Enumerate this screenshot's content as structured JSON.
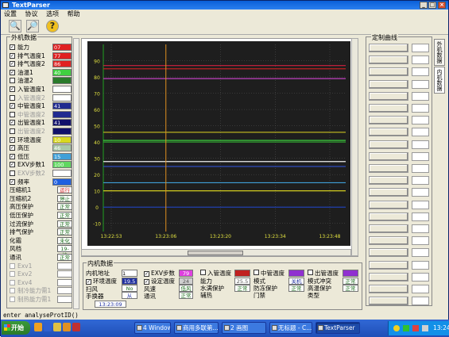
{
  "window": {
    "title": "TextParser"
  },
  "menu": [
    "设置",
    "协议",
    "选项",
    "帮助"
  ],
  "left_panel": {
    "title": "外机数据",
    "rows": [
      {
        "checked": true,
        "label": "能力",
        "value": "07",
        "color": "#e02020"
      },
      {
        "checked": true,
        "label": "排气温度1",
        "value": "77",
        "color": "#e02020"
      },
      {
        "checked": true,
        "label": "排气温度2",
        "value": "86",
        "color": "#e02020"
      },
      {
        "checked": true,
        "label": "油温1",
        "value": "40",
        "color": "#40d040"
      },
      {
        "checked": false,
        "label": "油温2",
        "value": "",
        "color": "#2a7a2a"
      },
      {
        "checked": true,
        "label": "入管温度1",
        "value": "",
        "color": "#ffffff"
      },
      {
        "checked": false,
        "label": "入管温度2",
        "value": "",
        "color": "#ffffff",
        "disabled": true
      },
      {
        "checked": true,
        "label": "中管温度1",
        "value": "41",
        "color": "#202a90"
      },
      {
        "checked": false,
        "label": "中管温度2",
        "value": "",
        "color": "#202a90",
        "disabled": true
      },
      {
        "checked": true,
        "label": "出管温度1",
        "value": "41",
        "color": "#10106a"
      },
      {
        "checked": false,
        "label": "出管温度2",
        "value": "",
        "color": "#10106a",
        "disabled": true
      },
      {
        "checked": true,
        "label": "环境温度",
        "value": "10",
        "color": "#d8d820"
      },
      {
        "checked": true,
        "label": "高压",
        "value": "46",
        "color": "#a8c8a8"
      },
      {
        "checked": true,
        "label": "低压",
        "value": "15",
        "color": "#3fa0d8"
      },
      {
        "checked": true,
        "label": "EXV步数1",
        "value": "100",
        "color": "#60d860"
      },
      {
        "checked": false,
        "label": "EXV步数2",
        "value": "",
        "color": "#ffffff",
        "disabled": true
      },
      {
        "checked": true,
        "label": "频率",
        "value": "0",
        "color": "#2060e0"
      }
    ],
    "status_rows": [
      {
        "label": "压缩机1",
        "state": "运行",
        "color": "#d02020"
      },
      {
        "label": "压缩机2",
        "state": "停止",
        "color": "#207020"
      },
      {
        "label": "高压保护",
        "state": "正常",
        "color": "#207020"
      },
      {
        "label": "低压保护",
        "state": "正常",
        "color": "#207020"
      },
      {
        "label": "过流保护",
        "state": "正常",
        "color": "#207020"
      },
      {
        "label": "排气保护",
        "state": "正常",
        "color": "#207020"
      },
      {
        "label": "化霜",
        "state": "未化霜",
        "color": "#207020"
      },
      {
        "label": "风档",
        "state": "19-档",
        "color": "#207020"
      },
      {
        "label": "通讯",
        "state": "正常",
        "color": "#207020"
      }
    ],
    "disabled_rows": [
      "Exv1",
      "Exv2",
      "Exv4",
      "制冷能力需1",
      "制热能力需1"
    ]
  },
  "chart_data": {
    "type": "line",
    "ylim": [
      -15,
      100
    ],
    "yticks": [
      90,
      80,
      70,
      60,
      50,
      40,
      30,
      20,
      10,
      0,
      -10
    ],
    "xticks": [
      "13:22:53",
      "13:23:06",
      "13:23:20",
      "13:23:34",
      "13:23:48"
    ],
    "cursor_x": "13:23:06",
    "series": [
      {
        "values": [
          87,
          87,
          87,
          87,
          87
        ],
        "color": "#d02040"
      },
      {
        "values": [
          85,
          85,
          85,
          85,
          85
        ],
        "color": "#c02020"
      },
      {
        "values": [
          79,
          79,
          79,
          79,
          79
        ],
        "color": "#c040c0"
      },
      {
        "values": [
          46,
          46,
          46,
          46,
          46
        ],
        "color": "#c8c020"
      },
      {
        "values": [
          41,
          41,
          41,
          41,
          41
        ],
        "color": "#40e040"
      },
      {
        "values": [
          40,
          40,
          40,
          40,
          40
        ],
        "color": "#30a030"
      },
      {
        "values": [
          28,
          28,
          28,
          28,
          28
        ],
        "color": "#f0f0f0"
      },
      {
        "values": [
          25,
          25,
          25,
          25,
          25
        ],
        "color": "#3050d0"
      },
      {
        "values": [
          15,
          15,
          15,
          15,
          15
        ],
        "color": "#3fa0d8"
      },
      {
        "values": [
          10,
          10,
          10,
          10,
          10
        ],
        "color": "#e8e020"
      },
      {
        "values": [
          0,
          0,
          0,
          0,
          0
        ],
        "color": "#2040b0"
      }
    ]
  },
  "right_panel": {
    "title": "定制曲线",
    "tabs": [
      "外机数据",
      "内机数据"
    ],
    "rows": 22
  },
  "inner_panel": {
    "title": "内机数据",
    "address_label": "内机地址",
    "address_value": "1",
    "exv_label": "EXV步数",
    "exv_value": "79",
    "env_label": "环境温度",
    "env_value": "19.5",
    "set_label": "设定温度",
    "set_value": "24",
    "scan_label": "扫风",
    "scan_value": "No Exv",
    "wind_label": "风速",
    "wind_value": "低风",
    "switch_label": "手换器",
    "switch_value": "从",
    "comm_label": "通讯",
    "comm_value": "正常",
    "time": "13:23:09",
    "in_temp_label": "入管温度",
    "in_temp_color": "#c02020",
    "mid_temp_label": "中管温度",
    "mid_temp_value": "25.5",
    "out_temp_label": "出管温度",
    "out_color": "#9030d0",
    "mode_label": "模式",
    "mode_value": "关机",
    "ability_label": "能力",
    "ability_value": "正常",
    "water_label": "水满保护",
    "water_value": "正常",
    "frost_label": "防冻保护",
    "frost_value": "正常",
    "conflict_label": "模式冲突",
    "conflict_value": "正常",
    "hiprot_label": "高温保护",
    "hiprot_value": "正常",
    "aux_label": "辅热",
    "door_label": "门禁",
    "type_label": "类型"
  },
  "command": "enter analyseProtID()",
  "taskbar": {
    "start": "开始",
    "items": [
      "4 Windows...",
      "商用多联第...",
      "2 画图",
      "无标题 - C...",
      "TextParser"
    ],
    "time": "13:24"
  }
}
